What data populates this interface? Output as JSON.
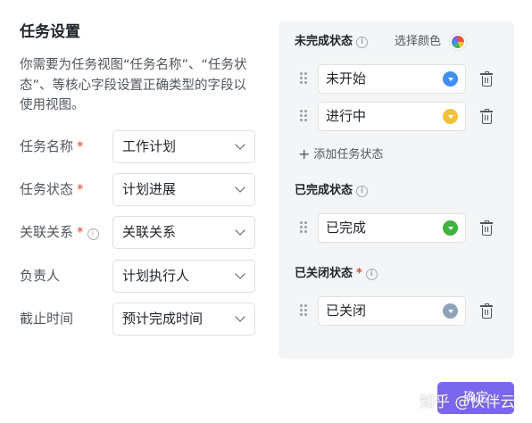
{
  "header": {
    "title": "任务设置",
    "description": "你需要为任务视图“任务名称”、“任务状态”、等核心字段设置正确类型的字段以使用视图。"
  },
  "fields": [
    {
      "label": "任务名称",
      "required": "*",
      "info": "",
      "value": "工作计划"
    },
    {
      "label": "任务状态",
      "required": "*",
      "info": "",
      "value": "计划进展"
    },
    {
      "label": "关联关系",
      "required": "*",
      "info": "i",
      "value": "关联关系"
    },
    {
      "label": "负责人",
      "required": "",
      "info": "",
      "value": "计划执行人"
    },
    {
      "label": "截止时间",
      "required": "",
      "info": "",
      "value": "预计完成时间"
    }
  ],
  "panel": {
    "pick_color_label": "选择颜色",
    "add_status_label": "添加任务状态",
    "add_icon": "+",
    "info_glyph": "i",
    "sections": {
      "incomplete": {
        "title": "未完成状态",
        "required": ""
      },
      "completed": {
        "title": "已完成状态",
        "required": ""
      },
      "closed": {
        "title": "已关闭状态",
        "required": "*"
      }
    },
    "statuses": {
      "not_started": {
        "label": "未开始",
        "color": "#3f8ef0"
      },
      "in_progress": {
        "label": "进行中",
        "color": "#f2c23d"
      },
      "done": {
        "label": "已完成",
        "color": "#3fb23f"
      },
      "closed": {
        "label": "已关闭",
        "color": "#8fa3b8"
      }
    }
  },
  "footer": {
    "confirm_label": "确定",
    "watermark": "知乎 @伙伴云"
  },
  "colors": {
    "accent": "#7b67ee",
    "required": "#e0452f",
    "panel_bg": "#f4f5f6"
  }
}
